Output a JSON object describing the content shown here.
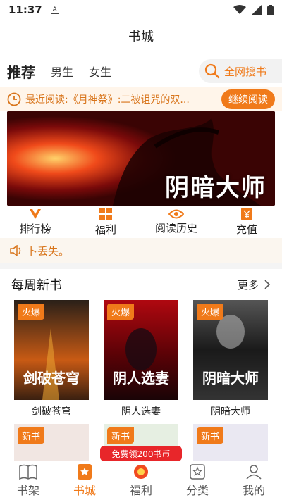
{
  "status_bar": {
    "time": "11:37",
    "indicator": "A"
  },
  "header": {
    "title": "书城"
  },
  "tabs": [
    {
      "label": "推荐",
      "active": true
    },
    {
      "label": "男生",
      "active": false
    },
    {
      "label": "女生",
      "active": false
    }
  ],
  "search": {
    "label": "全网搜书",
    "icon": "search-icon"
  },
  "recent": {
    "text": "最近阅读:《月神祭》:二被诅咒的双...",
    "continue_label": "继续阅读"
  },
  "banner": {
    "title": "阴暗大师"
  },
  "quick_nav": [
    {
      "label": "排行榜",
      "icon": "rank-icon"
    },
    {
      "label": "福利",
      "icon": "grid-icon"
    },
    {
      "label": "阅读历史",
      "icon": "eye-icon"
    },
    {
      "label": "充值",
      "icon": "yuan-icon"
    }
  ],
  "notice": {
    "text": "卜丢失。"
  },
  "section": {
    "title": "每周新书",
    "more_label": "更多"
  },
  "books": [
    {
      "title": "剑破苍穹",
      "tag": "火爆",
      "cover_text": "剑破苍穹"
    },
    {
      "title": "阴人选妻",
      "tag": "火爆",
      "cover_text": "阴人选妻"
    },
    {
      "title": "阴暗大师",
      "tag": "火爆",
      "cover_text": "阴暗大师"
    }
  ],
  "books_row2": [
    {
      "tag": "新书"
    },
    {
      "tag": "新书"
    },
    {
      "tag": "新书"
    }
  ],
  "promo": {
    "label": "免费领200书币"
  },
  "tabbar": [
    {
      "label": "书架",
      "icon": "book-icon",
      "active": false
    },
    {
      "label": "书城",
      "icon": "store-icon",
      "active": true
    },
    {
      "label": "福利",
      "icon": "gift-icon",
      "active": false
    },
    {
      "label": "分类",
      "icon": "category-icon",
      "active": false
    },
    {
      "label": "我的",
      "icon": "user-icon",
      "active": false
    }
  ],
  "colors": {
    "accent": "#f07a1a",
    "promo": "#e8262a",
    "notice_bg": "#fbf6ef"
  }
}
